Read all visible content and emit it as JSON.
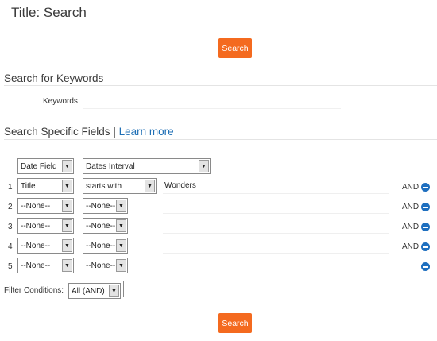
{
  "page": {
    "title": "Title: Search"
  },
  "buttons": {
    "search_top": "Search",
    "search_bottom": "Search"
  },
  "keywords": {
    "header": "Search for Keywords",
    "label": "Keywords",
    "value": ""
  },
  "fields": {
    "header": "Search Specific Fields",
    "separator": "|",
    "learn_more": "Learn more",
    "date_row": {
      "field": "Date Field",
      "interval": "Dates Interval"
    },
    "rows": [
      {
        "num": "1",
        "field": "Title",
        "operator": "starts with",
        "value": "Wonders",
        "connector": "AND"
      },
      {
        "num": "2",
        "field": "--None--",
        "operator": "--None--",
        "value": "",
        "connector": "AND"
      },
      {
        "num": "3",
        "field": "--None--",
        "operator": "--None--",
        "value": "",
        "connector": "AND"
      },
      {
        "num": "4",
        "field": "--None--",
        "operator": "--None--",
        "value": "",
        "connector": "AND"
      },
      {
        "num": "5",
        "field": "--None--",
        "operator": "--None--",
        "value": "",
        "connector": ""
      }
    ]
  },
  "filter": {
    "label": "Filter Conditions:",
    "value": "All (AND)"
  },
  "icons": {
    "dropdown": "triangle-down-icon",
    "remove": "minus-circle-icon"
  },
  "colors": {
    "accent": "#f46a1f",
    "link": "#1f6fb5",
    "remove_icon": "#1e6fbf"
  }
}
